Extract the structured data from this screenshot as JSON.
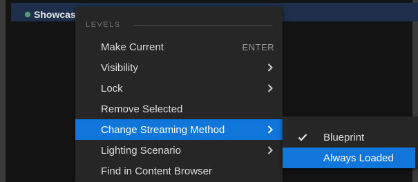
{
  "window": {
    "title": "Showcas"
  },
  "menu": {
    "section_header": "LEVELS",
    "items": [
      {
        "label": "Make Current",
        "shortcut": "ENTER",
        "has_submenu": false
      },
      {
        "label": "Visibility",
        "has_submenu": true
      },
      {
        "label": "Lock",
        "has_submenu": true
      },
      {
        "label": "Remove Selected",
        "has_submenu": false
      },
      {
        "label": "Change Streaming Method",
        "has_submenu": true,
        "highlighted": true
      },
      {
        "label": "Lighting Scenario",
        "has_submenu": true
      },
      {
        "label": "Find in Content Browser",
        "has_submenu": false
      }
    ]
  },
  "submenu": {
    "items": [
      {
        "label": "Blueprint",
        "checked": true
      },
      {
        "label": "Always Loaded",
        "highlighted": true
      }
    ]
  },
  "colors": {
    "highlight": "#1176d9",
    "menu_background": "#262626",
    "title_bar": "#1d2f4a"
  },
  "icons": {
    "submenu_arrow": "chevron-right-icon",
    "checked": "checkmark-icon",
    "level_status": "status-dot-icon"
  }
}
